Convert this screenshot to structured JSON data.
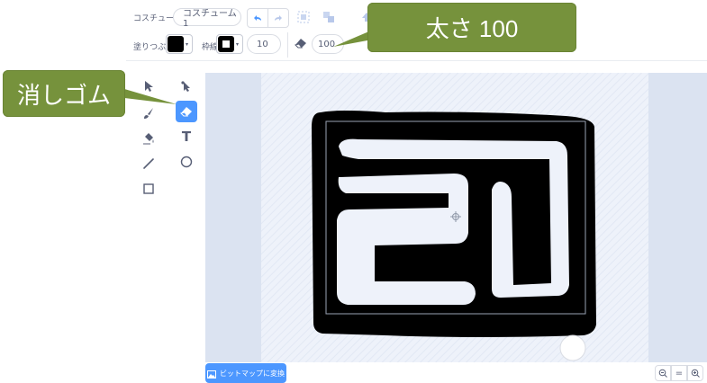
{
  "toolbar": {
    "costume_label": "コスチューム",
    "costume_name": "コスチューム1",
    "fill_label": "塗りつぶし",
    "fill_color": "#000000",
    "outline_label": "枠線",
    "outline_color": "#000000",
    "outline_width": "10",
    "eraser_size": "100"
  },
  "callouts": {
    "size": "太さ 100",
    "eraser": "消しゴム"
  },
  "tools": {
    "active": "eraser-tool",
    "text_glyph": "T"
  },
  "footer": {
    "bitmap_button": "ビットマップに変換",
    "zoom_reset": "="
  },
  "colors": {
    "accent": "#4c97ff",
    "callout": "#76923c",
    "stage_bg": "#dbe3f1",
    "canvas_bg": "#e8eef8"
  }
}
